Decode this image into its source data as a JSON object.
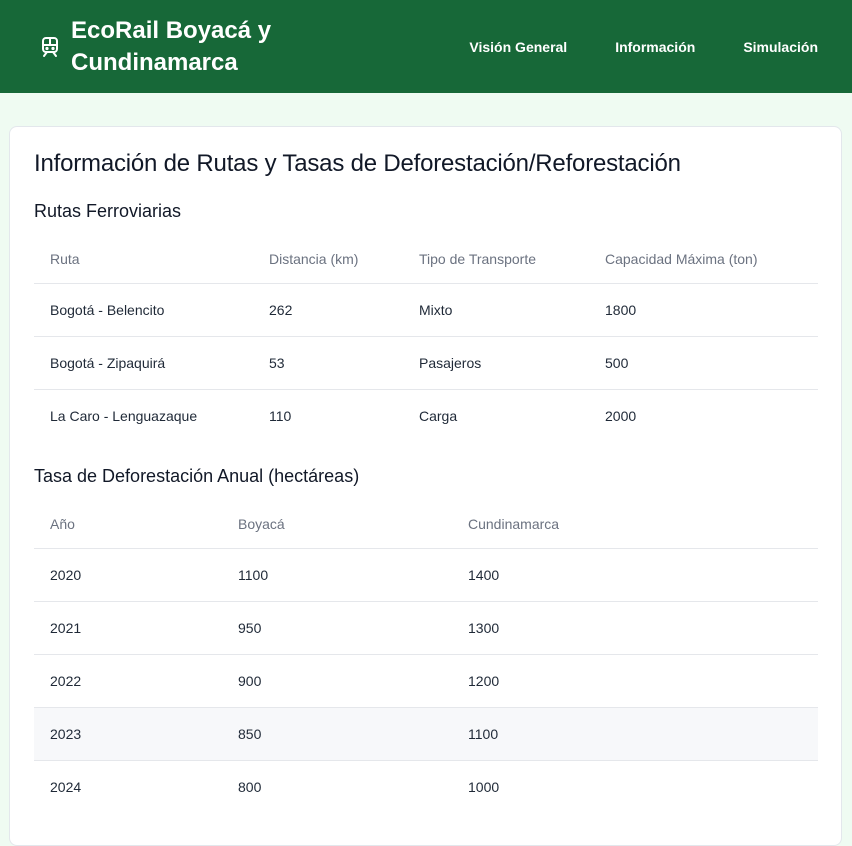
{
  "header": {
    "title": "EcoRail Boyacá y Cundinamarca",
    "icon": "train-icon",
    "nav": [
      {
        "label": "Visión General"
      },
      {
        "label": "Información"
      },
      {
        "label": "Simulación"
      }
    ]
  },
  "main": {
    "heading": "Información de Rutas y Tasas de Deforestación/Reforestación",
    "routes": {
      "title": "Rutas Ferroviarias",
      "columns": [
        "Ruta",
        "Distancia (km)",
        "Tipo de Transporte",
        "Capacidad Máxima (ton)"
      ],
      "rows": [
        [
          "Bogotá - Belencito",
          "262",
          "Mixto",
          "1800"
        ],
        [
          "Bogotá - Zipaquirá",
          "53",
          "Pasajeros",
          "500"
        ],
        [
          "La Caro - Lenguazaque",
          "110",
          "Carga",
          "2000"
        ]
      ]
    },
    "deforestation": {
      "title": "Tasa de Deforestación Anual (hectáreas)",
      "columns": [
        "Año",
        "Boyacá",
        "Cundinamarca"
      ],
      "rows": [
        [
          "2020",
          "1100",
          "1400"
        ],
        [
          "2021",
          "950",
          "1300"
        ],
        [
          "2022",
          "900",
          "1200"
        ],
        [
          "2023",
          "850",
          "1100"
        ],
        [
          "2024",
          "800",
          "1000"
        ]
      ]
    }
  },
  "colors": {
    "header_bg": "#176838",
    "page_bg": "#effbf2",
    "card_bg": "#ffffff",
    "muted_text": "#6b7280"
  }
}
